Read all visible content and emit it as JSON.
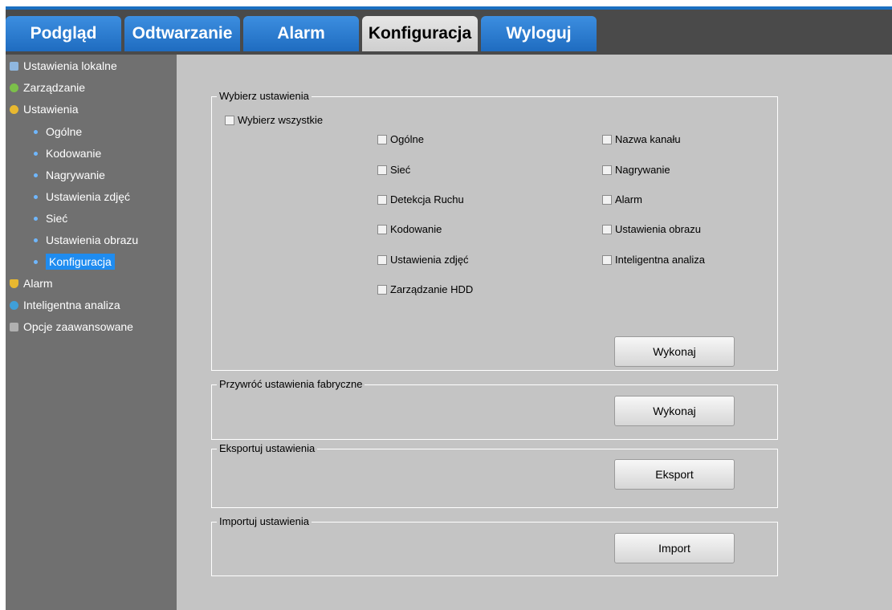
{
  "tabs": [
    {
      "label": "Podgląd"
    },
    {
      "label": "Odtwarzanie"
    },
    {
      "label": "Alarm"
    },
    {
      "label": "Konfiguracja",
      "active": true
    },
    {
      "label": "Wyloguj"
    }
  ],
  "sidebar": {
    "items": [
      {
        "label": "Ustawienia lokalne",
        "icon": "monitor-icon"
      },
      {
        "label": "Zarządzanie",
        "icon": "info-icon"
      },
      {
        "label": "Ustawienia",
        "icon": "gear-icon"
      },
      {
        "label": "Ogólne"
      },
      {
        "label": "Kodowanie"
      },
      {
        "label": "Nagrywanie"
      },
      {
        "label": "Ustawienia zdjęć"
      },
      {
        "label": "Sieć"
      },
      {
        "label": "Ustawienia obrazu"
      },
      {
        "label": "Konfiguracja",
        "selected": true
      },
      {
        "label": "Alarm",
        "icon": "bell-icon"
      },
      {
        "label": "Inteligentna analiza",
        "icon": "globe-icon"
      },
      {
        "label": "Opcje zaawansowane",
        "icon": "tools-icon"
      }
    ]
  },
  "select_settings": {
    "legend": "Wybierz ustawienia",
    "select_all": "Wybierz wszystkie",
    "left": [
      "Ogólne",
      "Sieć",
      "Detekcja Ruchu",
      "Kodowanie",
      "Ustawienia zdjęć",
      "Zarządzanie HDD"
    ],
    "right": [
      "Nazwa kanału",
      "Nagrywanie",
      "Alarm",
      "Ustawienia obrazu",
      "Inteligentna analiza"
    ],
    "button": "Wykonaj"
  },
  "restore": {
    "legend": "Przywróć ustawienia fabryczne",
    "button": "Wykonaj"
  },
  "export": {
    "legend": "Eksportuj ustawienia",
    "button": "Eksport"
  },
  "import": {
    "legend": "Importuj ustawienia",
    "button": "Import"
  },
  "colors": {
    "accent": "#1f6cc0",
    "sidebar": "#707070",
    "content": "#c4c4c4",
    "selected": "#1f8cf0"
  }
}
